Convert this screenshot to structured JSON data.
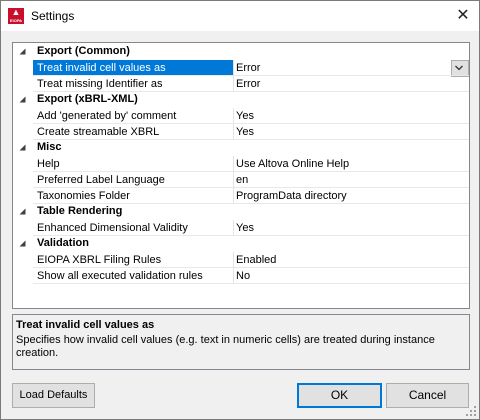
{
  "window": {
    "title": "Settings",
    "app_icon_text": "EIOPA",
    "close_glyph": "✕"
  },
  "grid": {
    "categories": [
      {
        "label": "Export (Common)",
        "rows": [
          {
            "name": "Treat invalid cell values as",
            "value": "Error",
            "selected": true
          },
          {
            "name": "Treat missing Identifier as",
            "value": "Error"
          }
        ]
      },
      {
        "label": "Export (xBRL-XML)",
        "rows": [
          {
            "name": "Add 'generated by' comment",
            "value": "Yes"
          },
          {
            "name": "Create streamable XBRL",
            "value": "Yes"
          }
        ]
      },
      {
        "label": "Misc",
        "rows": [
          {
            "name": "Help",
            "value": "Use Altova Online Help"
          },
          {
            "name": "Preferred Label Language",
            "value": "en"
          },
          {
            "name": "Taxonomies Folder",
            "value": "ProgramData directory"
          }
        ]
      },
      {
        "label": "Table Rendering",
        "rows": [
          {
            "name": "Enhanced Dimensional Validity",
            "value": "Yes"
          }
        ]
      },
      {
        "label": "Validation",
        "rows": [
          {
            "name": "EIOPA XBRL Filing Rules",
            "value": "Enabled"
          },
          {
            "name": "Show all executed validation rules",
            "value": "No"
          }
        ]
      }
    ]
  },
  "description": {
    "title": "Treat invalid cell values as",
    "text": "Specifies how invalid cell values (e.g. text in numeric cells) are treated during instance creation."
  },
  "buttons": {
    "load_defaults": "Load Defaults",
    "ok": "OK",
    "cancel": "Cancel"
  },
  "icons": {
    "expand": "collapse-triangle-icon",
    "dropdown": "chevron-down-icon",
    "grip": "resize-grip-icon"
  },
  "colors": {
    "selection": "#0078d7",
    "default_button_border": "#0078d7"
  }
}
